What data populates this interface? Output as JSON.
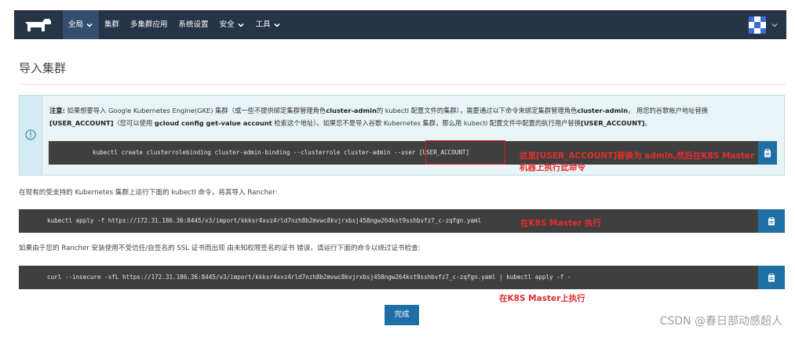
{
  "nav": {
    "items": [
      {
        "label": "全局",
        "has_menu": true,
        "active": true
      },
      {
        "label": "集群",
        "has_menu": false,
        "active": false
      },
      {
        "label": "多集群应用",
        "has_menu": false,
        "active": false
      },
      {
        "label": "系统设置",
        "has_menu": false,
        "active": false
      },
      {
        "label": "安全",
        "has_menu": true,
        "active": false
      },
      {
        "label": "工具",
        "has_menu": true,
        "active": false
      }
    ]
  },
  "page": {
    "title": "导入集群"
  },
  "info": {
    "note_label": "注意:",
    "text_1": " 如果想要导入 Google Kubernetes Engine(GKE) 集群（或一些不提供绑定集群管理角色",
    "bold_1": "cluster-admin",
    "text_2": "的 kubectl 配置文件的集群），需要通过以下命令来绑定集群管理角色",
    "bold_2": "cluster-admin",
    "text_3": "， 用您的谷歌帐户地址替换",
    "bold_3": "[USER_ACCOUNT]",
    "text_4": "（您可以使用 ",
    "bold_4": "gcloud config get-value account",
    "text_5": " 检索这个地址）。如果您不是导入谷歌 Kubernetes 集群，那么用 kubectl 配置文件中配置的执行用户替换",
    "bold_5": "[USER_ACCOUNT]",
    "text_6": "。",
    "command": "kubectl create clusterrolebinding cluster-admin-binding --clusterrole cluster-admin --user [USER_ACCOUNT]"
  },
  "annotations": {
    "a_line1": "这里[USER_ACCOUNT]替换为 admin,然后在K8S Master",
    "a_line2": "机器上执行此命令",
    "b": "在K8S Master 执行",
    "c": "在K8S Master上执行"
  },
  "section1": {
    "description": "在现有的受支持的 Kubernetes 集群上运行下面的 kubectl 命令，将其导入 Rancher:",
    "command": "kubectl apply -f https://172.31.186.36:8445/v3/import/kkksr4xvz4rld7nzh8b2mvwc8kvjrxbsj458ngw264kst9sshbvfz7_c-zqfgn.yaml"
  },
  "section2": {
    "description": "如果由于您的 Rancher 安装使用不受信任/自签名的 SSL 证书而出现 由未知权限签名的证书 错误，请运行下面的命令以绕过证书检查:",
    "command": "curl --insecure -sfL https://172.31.186.36:8445/v3/import/kkksr4xvz4rld7nzh8b2mvwc8kvjrxbsj458ngw264kst9sshbvfz7_c-zqfgn.yaml | kubectl apply -f -"
  },
  "done_label": "完成",
  "watermark": "CSDN @春日部动感超人",
  "colors": {
    "nav_bg": "#253447",
    "primary": "#1f6fa7",
    "annotation": "#e52e2e",
    "info_bg": "#e9f4f7"
  }
}
